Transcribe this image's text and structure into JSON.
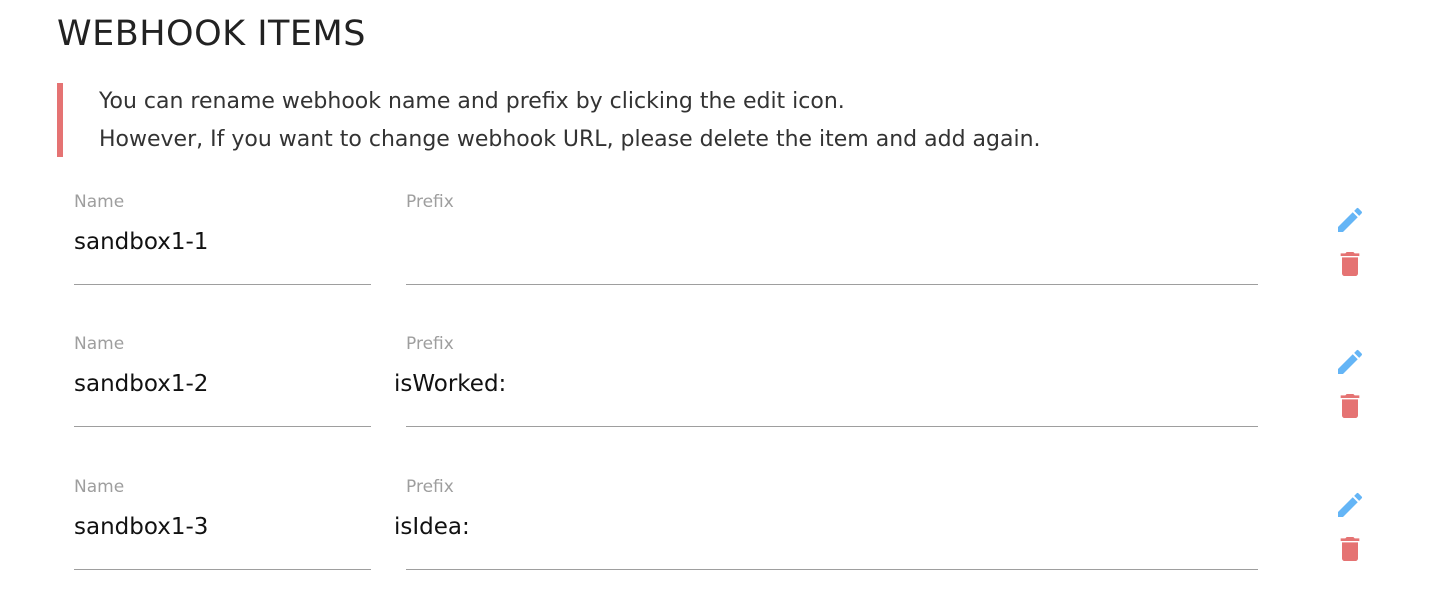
{
  "page": {
    "title": "WEBHOOK ITEMS"
  },
  "notice": {
    "line1": "You can rename webhook name and prefix by clicking the edit icon.",
    "line2": "However, If you want to change webhook URL, please delete the item and add again."
  },
  "colors": {
    "accent_border": "#e57373",
    "edit_icon": "#64b5f6",
    "delete_icon": "#e57373"
  },
  "icons": {
    "edit": "pencil-icon",
    "delete": "trash-icon"
  },
  "webhooks": [
    {
      "name_label": "Name",
      "name": "sandbox1-1",
      "prefix_label": "Prefix",
      "prefix": ""
    },
    {
      "name_label": "Name",
      "name": "sandbox1-2",
      "prefix_label": "Prefix",
      "prefix": "isWorked:"
    },
    {
      "name_label": "Name",
      "name": "sandbox1-3",
      "prefix_label": "Prefix",
      "prefix": "isIdea:"
    }
  ]
}
